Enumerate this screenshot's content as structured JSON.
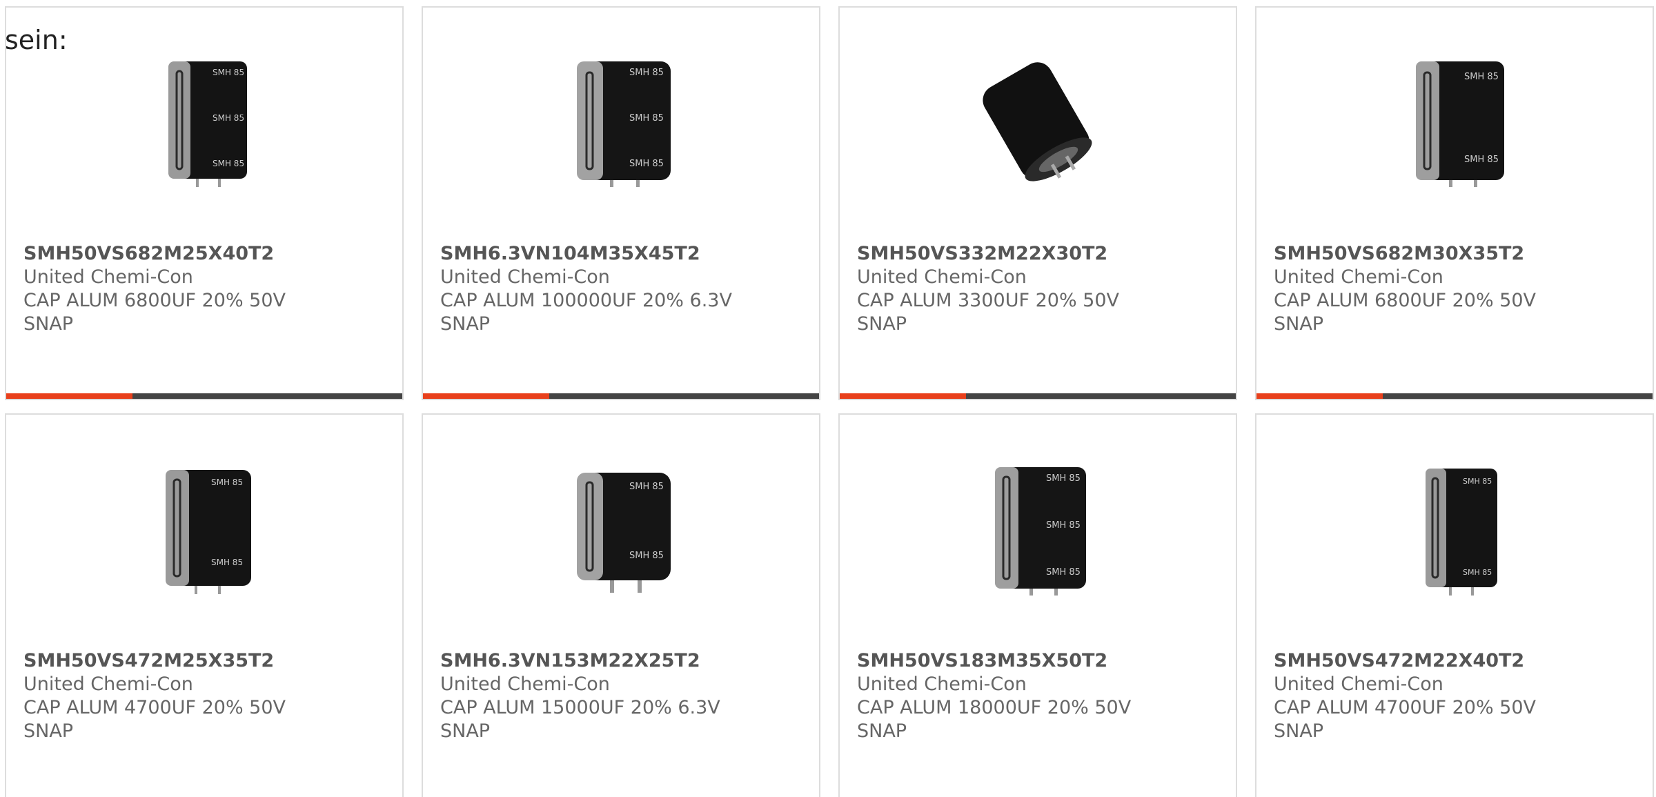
{
  "intro_text": "sein:",
  "colors": {
    "accent": "#e8401c",
    "bar": "#444444",
    "border": "#dddddd",
    "text": "#666666"
  },
  "products": [
    {
      "part_number": "SMH50VS682M25X40T2",
      "manufacturer": "United Chemi-Con",
      "desc": "CAP ALUM 6800UF 20% 50V",
      "mount": "SNAP",
      "image": "capacitor-upright-3-bands"
    },
    {
      "part_number": "SMH6.3VN104M35X45T2",
      "manufacturer": "United Chemi-Con",
      "desc": "CAP ALUM 100000UF 20% 6.3V",
      "mount": "SNAP",
      "image": "capacitor-upright-3-bands-wide"
    },
    {
      "part_number": "SMH50VS332M22X30T2",
      "manufacturer": "United Chemi-Con",
      "desc": "CAP ALUM 3300UF 20% 50V",
      "mount": "SNAP",
      "image": "capacitor-tilted"
    },
    {
      "part_number": "SMH50VS682M30X35T2",
      "manufacturer": "United Chemi-Con",
      "desc": "CAP ALUM 6800UF 20% 50V",
      "mount": "SNAP",
      "image": "capacitor-upright-2-bands"
    },
    {
      "part_number": "SMH50VS472M25X35T2",
      "manufacturer": "United Chemi-Con",
      "desc": "CAP ALUM 4700UF 20% 50V",
      "mount": "SNAP",
      "image": "capacitor-upright-2-bands"
    },
    {
      "part_number": "SMH6.3VN153M22X25T2",
      "manufacturer": "United Chemi-Con",
      "desc": "CAP ALUM 15000UF 20% 6.3V",
      "mount": "SNAP",
      "image": "capacitor-upright-2-bands-short"
    },
    {
      "part_number": "SMH50VS183M35X50T2",
      "manufacturer": "United Chemi-Con",
      "desc": "CAP ALUM 18000UF 20% 50V",
      "mount": "SNAP",
      "image": "capacitor-upright-3-bands-wide"
    },
    {
      "part_number": "SMH50VS472M22X40T2",
      "manufacturer": "United Chemi-Con",
      "desc": "CAP ALUM 4700UF 20% 50V",
      "mount": "SNAP",
      "image": "capacitor-upright-2-bands-narrow"
    }
  ]
}
